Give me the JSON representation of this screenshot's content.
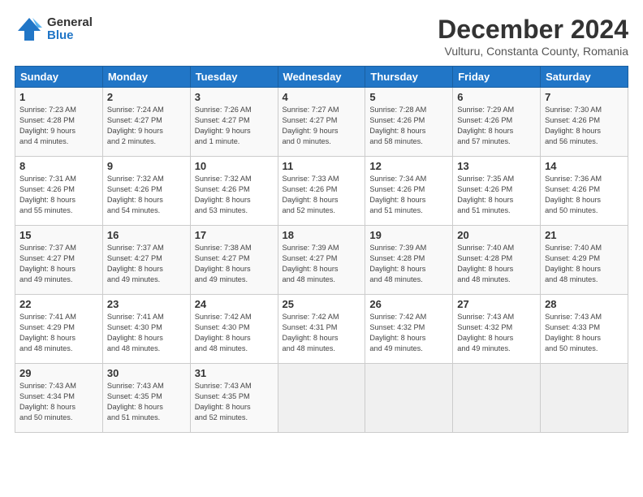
{
  "header": {
    "logo_general": "General",
    "logo_blue": "Blue",
    "month_title": "December 2024",
    "subtitle": "Vulturu, Constanta County, Romania"
  },
  "weekdays": [
    "Sunday",
    "Monday",
    "Tuesday",
    "Wednesday",
    "Thursday",
    "Friday",
    "Saturday"
  ],
  "weeks": [
    [
      {
        "day": "1",
        "info": "Sunrise: 7:23 AM\nSunset: 4:28 PM\nDaylight: 9 hours\nand 4 minutes."
      },
      {
        "day": "2",
        "info": "Sunrise: 7:24 AM\nSunset: 4:27 PM\nDaylight: 9 hours\nand 2 minutes."
      },
      {
        "day": "3",
        "info": "Sunrise: 7:26 AM\nSunset: 4:27 PM\nDaylight: 9 hours\nand 1 minute."
      },
      {
        "day": "4",
        "info": "Sunrise: 7:27 AM\nSunset: 4:27 PM\nDaylight: 9 hours\nand 0 minutes."
      },
      {
        "day": "5",
        "info": "Sunrise: 7:28 AM\nSunset: 4:26 PM\nDaylight: 8 hours\nand 58 minutes."
      },
      {
        "day": "6",
        "info": "Sunrise: 7:29 AM\nSunset: 4:26 PM\nDaylight: 8 hours\nand 57 minutes."
      },
      {
        "day": "7",
        "info": "Sunrise: 7:30 AM\nSunset: 4:26 PM\nDaylight: 8 hours\nand 56 minutes."
      }
    ],
    [
      {
        "day": "8",
        "info": "Sunrise: 7:31 AM\nSunset: 4:26 PM\nDaylight: 8 hours\nand 55 minutes."
      },
      {
        "day": "9",
        "info": "Sunrise: 7:32 AM\nSunset: 4:26 PM\nDaylight: 8 hours\nand 54 minutes."
      },
      {
        "day": "10",
        "info": "Sunrise: 7:32 AM\nSunset: 4:26 PM\nDaylight: 8 hours\nand 53 minutes."
      },
      {
        "day": "11",
        "info": "Sunrise: 7:33 AM\nSunset: 4:26 PM\nDaylight: 8 hours\nand 52 minutes."
      },
      {
        "day": "12",
        "info": "Sunrise: 7:34 AM\nSunset: 4:26 PM\nDaylight: 8 hours\nand 51 minutes."
      },
      {
        "day": "13",
        "info": "Sunrise: 7:35 AM\nSunset: 4:26 PM\nDaylight: 8 hours\nand 51 minutes."
      },
      {
        "day": "14",
        "info": "Sunrise: 7:36 AM\nSunset: 4:26 PM\nDaylight: 8 hours\nand 50 minutes."
      }
    ],
    [
      {
        "day": "15",
        "info": "Sunrise: 7:37 AM\nSunset: 4:27 PM\nDaylight: 8 hours\nand 49 minutes."
      },
      {
        "day": "16",
        "info": "Sunrise: 7:37 AM\nSunset: 4:27 PM\nDaylight: 8 hours\nand 49 minutes."
      },
      {
        "day": "17",
        "info": "Sunrise: 7:38 AM\nSunset: 4:27 PM\nDaylight: 8 hours\nand 49 minutes."
      },
      {
        "day": "18",
        "info": "Sunrise: 7:39 AM\nSunset: 4:27 PM\nDaylight: 8 hours\nand 48 minutes."
      },
      {
        "day": "19",
        "info": "Sunrise: 7:39 AM\nSunset: 4:28 PM\nDaylight: 8 hours\nand 48 minutes."
      },
      {
        "day": "20",
        "info": "Sunrise: 7:40 AM\nSunset: 4:28 PM\nDaylight: 8 hours\nand 48 minutes."
      },
      {
        "day": "21",
        "info": "Sunrise: 7:40 AM\nSunset: 4:29 PM\nDaylight: 8 hours\nand 48 minutes."
      }
    ],
    [
      {
        "day": "22",
        "info": "Sunrise: 7:41 AM\nSunset: 4:29 PM\nDaylight: 8 hours\nand 48 minutes."
      },
      {
        "day": "23",
        "info": "Sunrise: 7:41 AM\nSunset: 4:30 PM\nDaylight: 8 hours\nand 48 minutes."
      },
      {
        "day": "24",
        "info": "Sunrise: 7:42 AM\nSunset: 4:30 PM\nDaylight: 8 hours\nand 48 minutes."
      },
      {
        "day": "25",
        "info": "Sunrise: 7:42 AM\nSunset: 4:31 PM\nDaylight: 8 hours\nand 48 minutes."
      },
      {
        "day": "26",
        "info": "Sunrise: 7:42 AM\nSunset: 4:32 PM\nDaylight: 8 hours\nand 49 minutes."
      },
      {
        "day": "27",
        "info": "Sunrise: 7:43 AM\nSunset: 4:32 PM\nDaylight: 8 hours\nand 49 minutes."
      },
      {
        "day": "28",
        "info": "Sunrise: 7:43 AM\nSunset: 4:33 PM\nDaylight: 8 hours\nand 50 minutes."
      }
    ],
    [
      {
        "day": "29",
        "info": "Sunrise: 7:43 AM\nSunset: 4:34 PM\nDaylight: 8 hours\nand 50 minutes."
      },
      {
        "day": "30",
        "info": "Sunrise: 7:43 AM\nSunset: 4:35 PM\nDaylight: 8 hours\nand 51 minutes."
      },
      {
        "day": "31",
        "info": "Sunrise: 7:43 AM\nSunset: 4:35 PM\nDaylight: 8 hours\nand 52 minutes."
      },
      null,
      null,
      null,
      null
    ]
  ]
}
